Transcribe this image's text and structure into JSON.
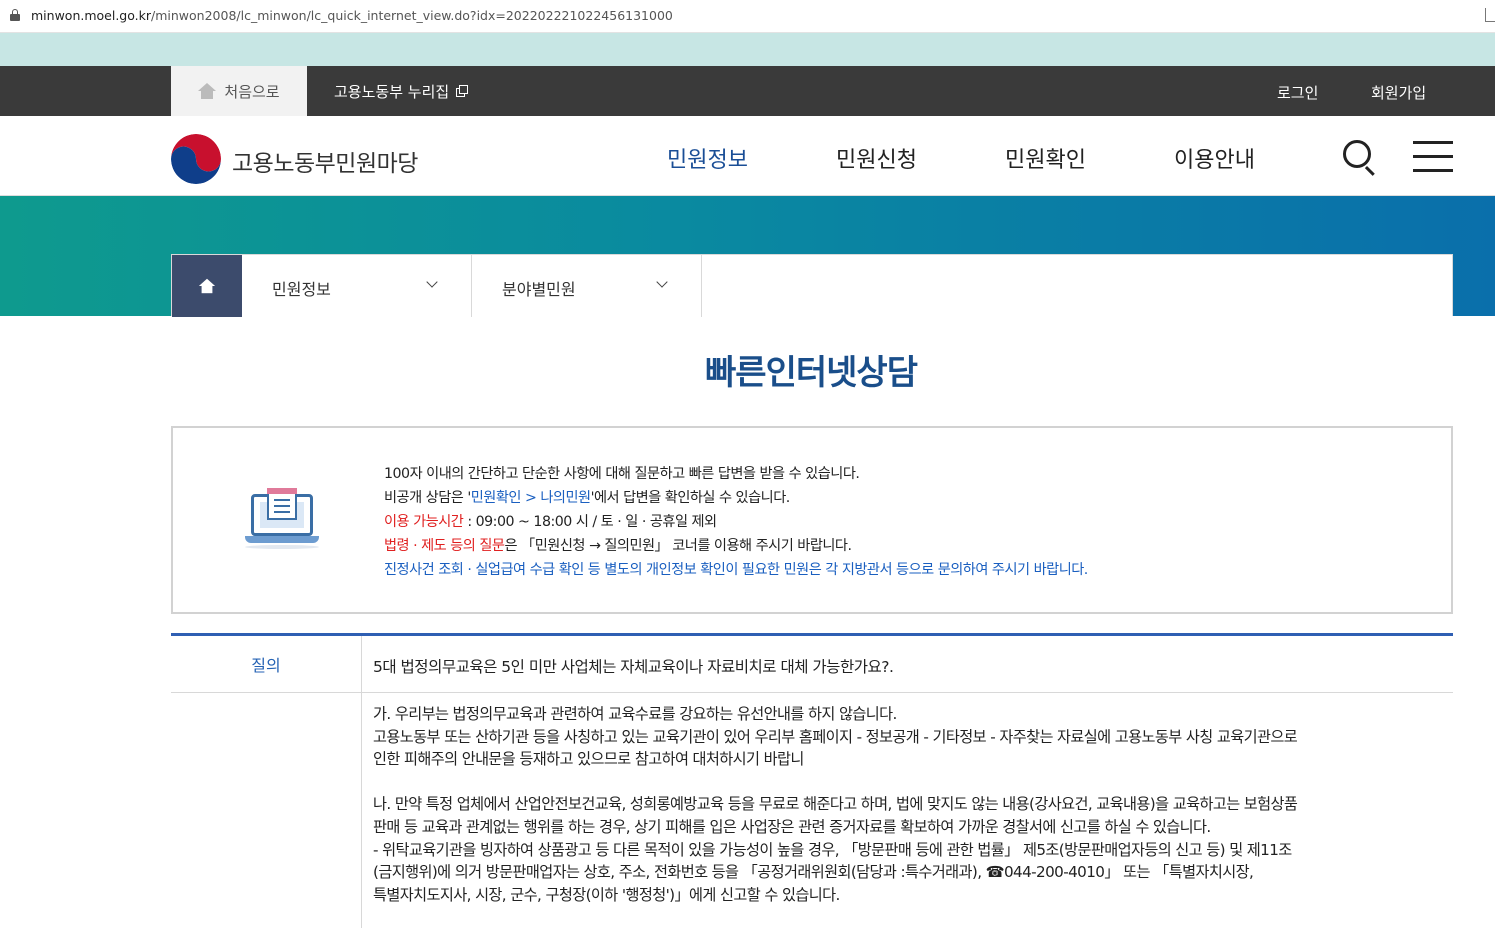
{
  "browser": {
    "url_host": "minwon.moel.go.kr",
    "url_path": "/minwon2008/lc_minwon/lc_quick_internet_view.do?idx=202202221022456131000"
  },
  "topbar": {
    "home_tab": "처음으로",
    "nuri_link": "고용노동부 누리집",
    "login": "로그인",
    "join": "회원가입"
  },
  "header": {
    "logo_text": "고용노동부민원마당",
    "nav": [
      "민원정보",
      "민원신청",
      "민원확인",
      "이용안내"
    ]
  },
  "breadcrumb": {
    "level1": "민원정보",
    "level2": "분야별민원"
  },
  "page": {
    "title": "빠른인터넷상담"
  },
  "info": {
    "line1": "100자 이내의 간단하고 단순한 사항에 대해 질문하고 빠른 답변을 받을 수 있습니다.",
    "line2_pre": "비공개 상담은 '",
    "line2_link": "민원확인 > 나의민원",
    "line2_post": "'에서 답변을 확인하실 수 있습니다.",
    "line3_label": "이용 가능시간",
    "line3_text": " : 09:00 ~ 18:00 시 / 토 · 일 · 공휴일 제외",
    "line4_label": "법령 · 제도 등의 질문",
    "line4_text": "은 「민원신청 → 질의민원」 코너를 이용해 주시기 바랍니다.",
    "line5": "진정사건 조회 · 실업급여 수급 확인 등 별도의 개인정보 확인이 필요한 민원은 각 지방관서 등으로 문의하여 주시기 바랍니다."
  },
  "qna": {
    "question_label": "질의",
    "question": "5대 법정의무교육은 5인 미만 사업체는 자체교육이나 자료비치로 대체 가능한가요?.",
    "answer_lines": [
      "가. 우리부는 법정의무교육과 관련하여 교육수료를 강요하는 유선안내를 하지 않습니다.",
      "고용노동부 또는 산하기관 등을 사칭하고 있는 교육기관이 있어 우리부 홈페이지 - 정보공개 - 기타정보 - 자주찾는 자료실에 고용노동부 사칭 교육기관으로",
      "인한 피해주의 안내문을 등재하고 있으므로 참고하여 대처하시기 바랍니",
      "",
      "나. 만약 특정 업체에서 산업안전보건교육, 성희롱예방교육 등을 무료로 해준다고 하며, 법에 맞지도 않는 내용(강사요건, 교육내용)을 교육하고는 보험상품",
      "판매 등 교육과 관계없는 행위를 하는 경우, 상기 피해를 입은 사업장은 관련 증거자료를 확보하여 가까운 경찰서에 신고를 하실 수 있습니다.",
      "- 위탁교육기관을 빙자하여 상품광고 등 다른 목적이 있을 가능성이 높을 경우, 「방문판매 등에 관한 법률」 제5조(방문판매업자등의 신고 등) 및 제11조",
      "(금지행위)에 의거 방문판매업자는 상호, 주소, 전화번호 등을 「공정거래위원회(담당과 :특수거래과), ☎044-200-4010」 또는 「특별자치시장,",
      "특별자치도지사, 시장, 군수, 구청장(이하 '행정청')」에게 신고할 수 있습니다."
    ]
  },
  "colors": {
    "accent_blue": "#1a4e96",
    "title_blue": "#1a4e8a",
    "notice_red": "#e02020",
    "table_top_border": "#2f5fb3",
    "topbar_dark": "#3a3a3a"
  },
  "icons": [
    "lock-icon",
    "home-icon",
    "external-link-icon",
    "government-logo",
    "search-icon",
    "hamburger-menu-icon",
    "chevron-down-icon",
    "computer-consultation-icon"
  ]
}
